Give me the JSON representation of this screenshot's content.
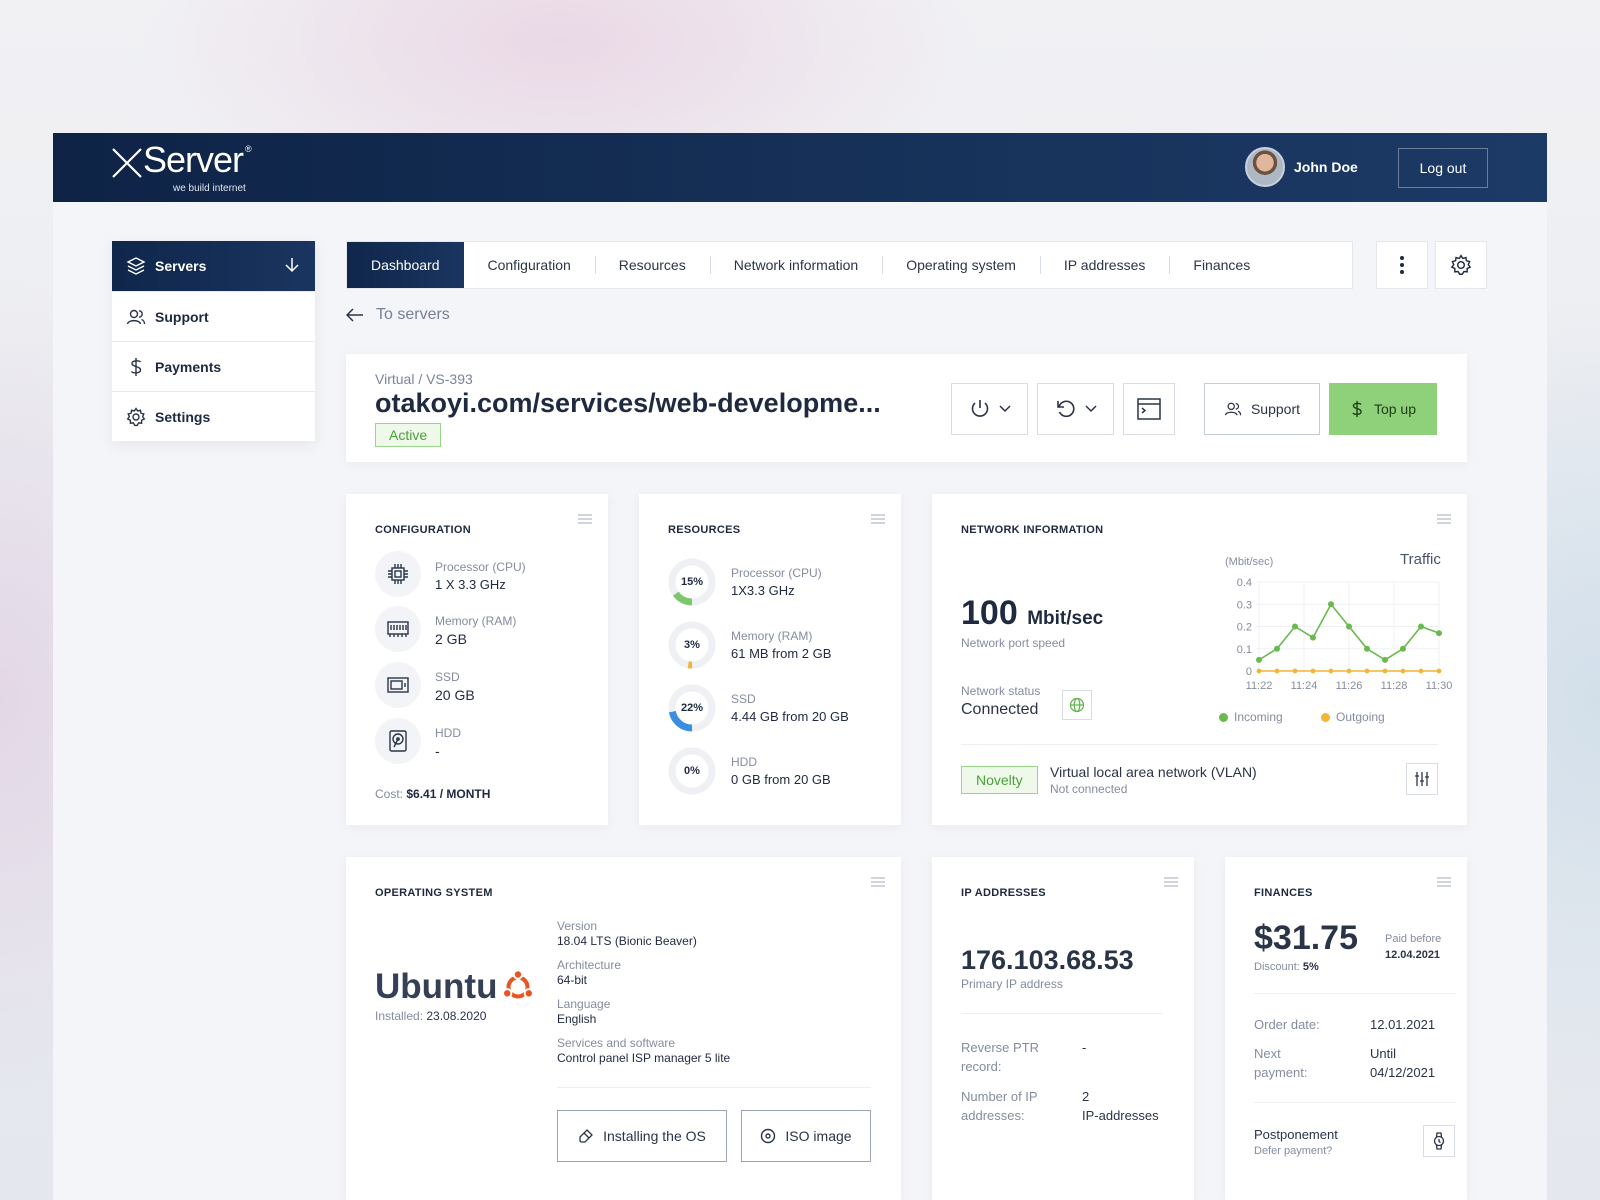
{
  "brand": {
    "name": "Server",
    "mark": "®",
    "tagline": "we build internet"
  },
  "user": {
    "name": "John Doe",
    "logout_label": "Log out"
  },
  "sidebar": {
    "items": [
      {
        "label": "Servers",
        "icon": "layers-icon",
        "active": true
      },
      {
        "label": "Support",
        "icon": "users-icon"
      },
      {
        "label": "Payments",
        "icon": "dollar-icon"
      },
      {
        "label": "Settings",
        "icon": "gear-icon"
      }
    ]
  },
  "tabs": [
    "Dashboard",
    "Configuration",
    "Resources",
    "Network information",
    "Operating system",
    "IP addresses",
    "Finances"
  ],
  "back_label": "To servers",
  "server": {
    "crumb": "Virtual / VS-393",
    "host": "otakoyi.com/services/web-developme...",
    "status": "Active",
    "support_label": "Support",
    "topup_label": "Top up"
  },
  "configuration": {
    "title": "CONFIGURATION",
    "items": [
      {
        "label": "Processor (CPU)",
        "value": "1 X 3.3 GHz",
        "icon": "cpu-icon"
      },
      {
        "label": "Memory (RAM)",
        "value": "2 GB",
        "icon": "ram-icon"
      },
      {
        "label": "SSD",
        "value": "20 GB",
        "icon": "ssd-icon"
      },
      {
        "label": "HDD",
        "value": "-",
        "icon": "hdd-icon"
      }
    ],
    "cost_label": "Cost:",
    "cost_value": "$6.41 / MONTH"
  },
  "resources": {
    "title": "RESOURCES",
    "items": [
      {
        "label": "Processor (CPU)",
        "value": "1X3.3 GHz",
        "percent_text": "15%",
        "percent": 15,
        "color": "#7cc76a"
      },
      {
        "label": "Memory (RAM)",
        "value": "61 MB from 2 GB",
        "percent_text": "3%",
        "percent": 3,
        "color": "#f2b534"
      },
      {
        "label": "SSD",
        "value": "4.44 GB from 20 GB",
        "percent_text": "22%",
        "percent": 22,
        "color": "#3a8ee0"
      },
      {
        "label": "HDD",
        "value": "0 GB from 20 GB",
        "percent_text": "0%",
        "percent": 0,
        "color": "#d8dde5"
      }
    ]
  },
  "network": {
    "title": "NETWORK INFORMATION",
    "speed_value": "100",
    "speed_unit": "Mbit/sec",
    "speed_label": "Network port speed",
    "status_label": "Network status",
    "status_value": "Connected",
    "novelty": "Novelty",
    "vlan_title": "Virtual local area network (VLAN)",
    "vlan_status": "Not connected"
  },
  "chart_data": {
    "type": "line",
    "title": "Traffic",
    "ylabel": "(Mbit/sec)",
    "ylim": [
      0,
      0.4
    ],
    "yticks": [
      "0",
      "0.1",
      "0.2",
      "0.3",
      "0.4"
    ],
    "xticks": [
      "11:22",
      "11:24",
      "11:26",
      "11:28",
      "11:30"
    ],
    "series": [
      {
        "name": "Incoming",
        "color": "#6ab84e",
        "values": [
          0.05,
          0.1,
          0.2,
          0.15,
          0.3,
          0.2,
          0.1,
          0.05,
          0.1,
          0.2,
          0.17
        ]
      },
      {
        "name": "Outgoing",
        "color": "#f2b534",
        "values": [
          0,
          0,
          0,
          0,
          0,
          0,
          0,
          0,
          0,
          0,
          0
        ]
      }
    ]
  },
  "os": {
    "title": "OPERATING SYSTEM",
    "name": "Ubuntu",
    "installed_label": "Installed:",
    "installed_date": "23.08.2020",
    "info": [
      {
        "label": "Version",
        "value": "18.04 LTS (Bionic Beaver)"
      },
      {
        "label": "Architecture",
        "value": "64-bit"
      },
      {
        "label": "Language",
        "value": "English"
      },
      {
        "label": "Services and software",
        "value": "Control panel ISP manager 5 lite"
      }
    ],
    "install_label": "Installing the OS",
    "iso_label": "ISO image"
  },
  "ip": {
    "title": "IP ADDRESSES",
    "primary": "176.103.68.53",
    "primary_label": "Primary IP address",
    "ptr_label_1": "Reverse PTR",
    "ptr_label_2": "record:",
    "ptr_value": "-",
    "count_label_1": "Number of IP",
    "count_label_2": "addresses:",
    "count_value_1": "2",
    "count_value_2": "IP-addresses"
  },
  "finances": {
    "title": "FINANCES",
    "amount": "$31.75",
    "discount_label": "Discount:",
    "discount_value": "5%",
    "paid_label": "Paid before",
    "paid_value": "12.04.2021",
    "order_label": "Order date:",
    "order_value": "12.01.2021",
    "next_label_1": "Next",
    "next_label_2": "payment:",
    "next_value_1": "Until",
    "next_value_2": "04/12/2021",
    "post_title": "Postponement",
    "post_sub": "Defer payment?"
  }
}
